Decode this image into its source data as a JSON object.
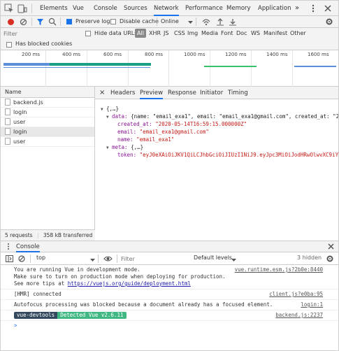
{
  "devtools": {
    "tabs": [
      "Elements",
      "Vue",
      "Console",
      "Sources",
      "Network",
      "Performance",
      "Memory",
      "Application"
    ],
    "active_tab": "Network",
    "more": "»"
  },
  "network_toolbar": {
    "preserve_log": "Preserve log",
    "disable_cache": "Disable cache",
    "throttle": "Online"
  },
  "filter": {
    "placeholder": "Filter",
    "hide_data_urls": "Hide data URLs",
    "types": [
      "All",
      "XHR",
      "JS",
      "CSS",
      "Img",
      "Media",
      "Font",
      "Doc",
      "WS",
      "Manifest",
      "Other"
    ],
    "active_type": "All",
    "has_blocked_cookies": "Has blocked cookies"
  },
  "timeline": {
    "ticks": [
      "200 ms",
      "400 ms",
      "600 ms",
      "800 ms",
      "1000 ms",
      "1200 ms",
      "1400 ms",
      "1600 ms"
    ]
  },
  "requests": {
    "header": "Name",
    "items": [
      "backend.js",
      "login",
      "user",
      "login",
      "user"
    ],
    "selected_index": 3,
    "status": "5 requests",
    "transferred": "358 kB transferred"
  },
  "detail": {
    "tabs": [
      "Headers",
      "Preview",
      "Response",
      "Initiator",
      "Timing"
    ],
    "active_tab": "Preview",
    "close": "×",
    "json": {
      "root": "{,…}",
      "data_key": "data:",
      "data_summary": "{name: \"email_exa1\", email: \"email_exa1@gmail.com\", created_at: \"2020",
      "created_at_key": "created_at:",
      "created_at_val": "\"2020-05-14T16:59:15.000000Z\"",
      "email_key": "email:",
      "email_val": "\"email_exa1@gmail.com\"",
      "name_key": "name:",
      "name_val": "\"email_exa1\"",
      "meta_key": "meta:",
      "meta_summary": "{,…}",
      "token_key": "token:",
      "token_val": "\"eyJ0eXAiOiJKV1QiLCJhbGciOiJIUzI1NiJ9.eyJpc3MiOiJodHRwOlwvXC9iYWNr"
    }
  },
  "console": {
    "title": "Console",
    "context": "top",
    "filter_placeholder": "Filter",
    "levels": "Default levels",
    "hidden": "3 hidden",
    "messages": [
      {
        "lines": [
          "You are running Vue in development mode.",
          "Make sure to turn on production mode when deploying for production.",
          "See more tips at "
        ],
        "link": "https://vuejs.org/guide/deployment.html",
        "source": "vue.runtime.esm.js?2b0e:8440"
      },
      {
        "lines": [
          "[HMR] connected"
        ],
        "source": "client.js?e0ba:95"
      },
      {
        "lines": [
          "Autofocus processing was blocked because a document already has a focused element."
        ],
        "source": "login:1"
      }
    ],
    "devtools_badge": "vue-devtools",
    "detected_badge": "Detected Vue v2.6.11",
    "devtools_source": "backend.js:2237",
    "prompt": ">"
  },
  "colors": {
    "accent": "#1a73e8",
    "record": "#d93025",
    "json_key": "#881391",
    "json_string": "#c41a16",
    "timeline_blue": "#5b8fd8",
    "timeline_teal": "#1aa085",
    "timeline_green": "#39c06b",
    "vue_dark": "#35495e",
    "vue_green": "#41b883"
  }
}
